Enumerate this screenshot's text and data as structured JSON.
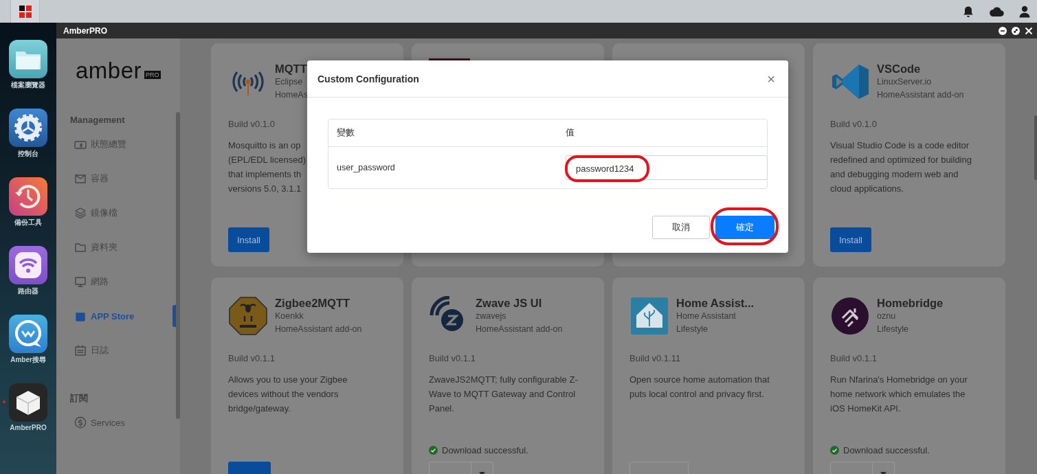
{
  "dock": [
    {
      "label": "檔案瀏覽器",
      "running": false
    },
    {
      "label": "控制台",
      "running": false
    },
    {
      "label": "備份工具",
      "running": false
    },
    {
      "label": "路由器",
      "running": false
    },
    {
      "label": "Amber搜尋",
      "running": false
    },
    {
      "label": "AmberPRO",
      "running": true
    }
  ],
  "window": {
    "title": "AmberPRO"
  },
  "sidebar": {
    "logo": "amber",
    "logo_badge": "PRO",
    "sections": [
      {
        "heading": "Management",
        "items": [
          {
            "label": "狀態總覽",
            "selected": false
          },
          {
            "label": "容器",
            "selected": false
          },
          {
            "label": "鏡像檔",
            "selected": false
          },
          {
            "label": "資料夾",
            "selected": false
          },
          {
            "label": "網路",
            "selected": false
          },
          {
            "label": "APP Store",
            "selected": true
          },
          {
            "label": "日誌",
            "selected": false
          }
        ]
      },
      {
        "heading": "訂閱",
        "items": [
          {
            "label": "Services",
            "selected": false
          }
        ]
      }
    ]
  },
  "cards": [
    {
      "kind": "app",
      "title": "MQTT",
      "publisher": "Eclipse",
      "category": "HomeAs",
      "build": "Build v0.1.0",
      "description_lines": [
        "Mosquitto is an op",
        "(EPL/EDL licensed)",
        "that implements th",
        "versions 5.0, 3.1.1"
      ],
      "button": {
        "label": "Install",
        "kind": "primary"
      }
    },
    {
      "kind": "covered"
    },
    {
      "kind": "covered"
    },
    {
      "kind": "app",
      "title": "VSCode",
      "publisher": "LinuxServer.io",
      "category": "HomeAssistant add-on",
      "build": "Build v0.1.0",
      "description_lines": [
        "Visual Studio Code is a code editor",
        "redefined and optimized for building",
        "and debugging modern web and",
        "cloud applications."
      ],
      "button": {
        "label": "Install",
        "kind": "primary"
      }
    },
    {
      "kind": "app",
      "title": "Zigbee2MQTT",
      "publisher": "Koenkk",
      "category": "HomeAssistant add-on",
      "build": "Build v0.1.1",
      "description_lines": [
        "Allows you to use your Zigbee",
        "devices without the vendors",
        "bridge/gateway."
      ],
      "button": {
        "kind": "primary"
      }
    },
    {
      "kind": "app",
      "title": "Zwave JS UI",
      "publisher": "zwavejs",
      "category": "HomeAssistant add-on",
      "build": "Build v0.1.1",
      "description_lines": [
        "ZwaveJS2MQTT; fully configurable Z-",
        "Wave to MQTT Gateway and Control",
        "Panel."
      ],
      "status": "Download successful.",
      "button": {
        "kind": "split"
      }
    },
    {
      "kind": "app",
      "title": "Home Assist...",
      "publisher": "Home Assistant",
      "category": "Lifestyle",
      "build": "Build v0.1.11",
      "description_lines": [
        "Open source home automation that",
        "puts local control and privacy first."
      ],
      "button": {
        "kind": "outline"
      }
    },
    {
      "kind": "app",
      "title": "Homebridge",
      "publisher": "oznu",
      "category": "Lifestyle",
      "build": "Build v0.1.1",
      "description_lines": [
        "Run Nfarina's Homebridge on your",
        "home network which emulates the",
        "iOS HomeKit API."
      ],
      "status": "Download successful.",
      "button": {
        "kind": "split"
      }
    }
  ],
  "dialog": {
    "title": "Custom Configuration",
    "close": "×",
    "columns": [
      "變數",
      "值"
    ],
    "rows": [
      {
        "name": "user_password",
        "value": "password1234",
        "highlighted": true
      }
    ],
    "buttons": [
      {
        "label": "取消",
        "kind": "secondary",
        "highlighted": false
      },
      {
        "label": "確定",
        "kind": "primary",
        "highlighted": true
      }
    ]
  }
}
